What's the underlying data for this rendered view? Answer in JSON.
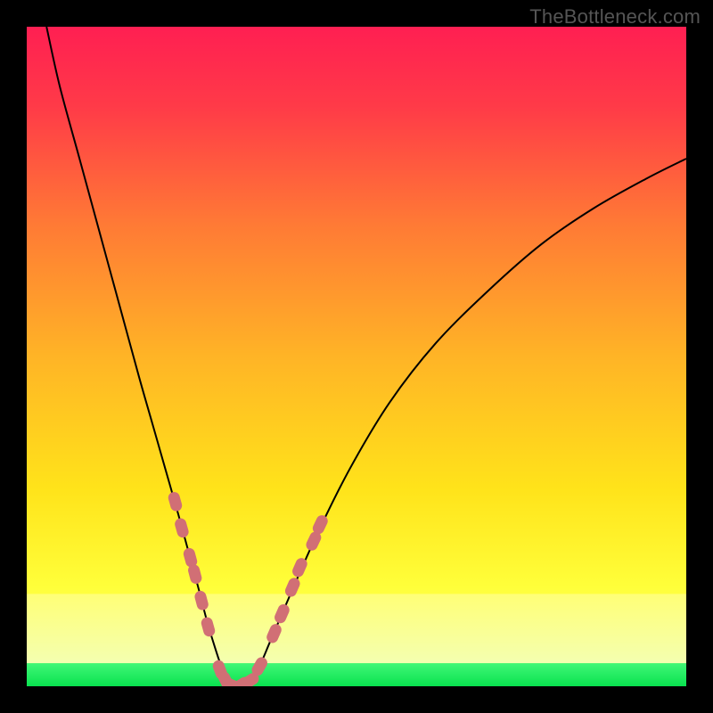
{
  "watermark": "TheBottleneck.com",
  "chart_data": {
    "type": "line",
    "title": "",
    "xlabel": "",
    "ylabel": "",
    "xlim": [
      0,
      100
    ],
    "ylim": [
      0,
      100
    ],
    "series": [
      {
        "name": "bottleneck-curve",
        "x": [
          3,
          5,
          8,
          11,
          14,
          17,
          19,
          21,
          23,
          24.5,
          26,
          27.3,
          28.5,
          29.5,
          30.3,
          31,
          33,
          35,
          37,
          40,
          44,
          49,
          55,
          62,
          70,
          78,
          86,
          94,
          100
        ],
        "y": [
          100,
          91,
          80,
          69,
          58,
          47,
          40,
          33,
          26,
          20.5,
          15,
          10,
          6,
          3,
          1.2,
          0,
          0,
          2.5,
          7,
          14,
          23,
          33,
          43,
          52,
          60,
          67,
          72.5,
          77,
          80
        ]
      }
    ],
    "markers": {
      "name": "highlight-dots",
      "color": "#d16f75",
      "points": [
        {
          "x": 22.5,
          "y": 28
        },
        {
          "x": 23.5,
          "y": 24
        },
        {
          "x": 24.8,
          "y": 19.5
        },
        {
          "x": 25.5,
          "y": 17
        },
        {
          "x": 26.5,
          "y": 13
        },
        {
          "x": 27.5,
          "y": 9
        },
        {
          "x": 29.3,
          "y": 2.5
        },
        {
          "x": 30.2,
          "y": 0.8
        },
        {
          "x": 31.0,
          "y": 0.2
        },
        {
          "x": 32.5,
          "y": 0.2
        },
        {
          "x": 33.8,
          "y": 0.8
        },
        {
          "x": 35.3,
          "y": 3
        },
        {
          "x": 37.5,
          "y": 8
        },
        {
          "x": 38.7,
          "y": 11
        },
        {
          "x": 40.3,
          "y": 15
        },
        {
          "x": 41.4,
          "y": 18
        },
        {
          "x": 43.5,
          "y": 22
        },
        {
          "x": 44.5,
          "y": 24.5
        }
      ]
    },
    "bands": [
      {
        "name": "green-band",
        "y0": 0.0,
        "y1": 3.5,
        "color_top": "#41f777",
        "color_bottom": "#09e24f"
      },
      {
        "name": "pale-band",
        "y0": 3.5,
        "y1": 14.0,
        "color_top": "#ffff76",
        "color_bottom": "#f4ffb0"
      }
    ],
    "gradient_stops": [
      {
        "offset": 0.0,
        "color": "#ff1f52"
      },
      {
        "offset": 0.12,
        "color": "#ff3a48"
      },
      {
        "offset": 0.3,
        "color": "#ff7a35"
      },
      {
        "offset": 0.5,
        "color": "#ffb426"
      },
      {
        "offset": 0.7,
        "color": "#ffe31a"
      },
      {
        "offset": 0.85,
        "color": "#ffff3a"
      },
      {
        "offset": 1.0,
        "color": "#ffff76"
      }
    ]
  }
}
